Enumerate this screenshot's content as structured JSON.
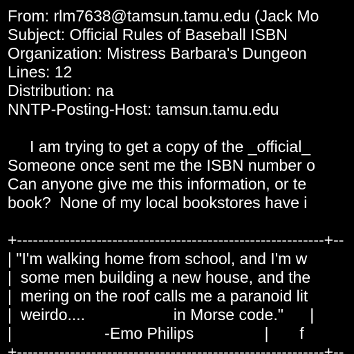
{
  "header": {
    "from": "From: rlm7638@tamsun.tamu.edu (Jack Mo",
    "subject": "Subject: Official Rules of Baseball ISBN",
    "organization": "Organization: Mistress Barbara's Dungeon",
    "lines": "Lines: 12",
    "distribution": "Distribution: na",
    "nntp_host": "NNTP-Posting-Host: tamsun.tamu.edu"
  },
  "body": [
    "     I am trying to get a copy of the _official_",
    "Someone once sent me the ISBN number o",
    "Can anyone give me this information, or te",
    "book?  None of my local bookstores have i"
  ],
  "signature": [
    "+----------------------------------------------------------+--",
    "| \"I'm walking home from school, and I'm w",
    "|  some men building a new house, and the",
    "|  mering on the roof calls me a paranoid lit",
    "|  weirdo....                    in Morse code.\"      |",
    "|                     -Emo Philips                |       f",
    "+----------------------------------------------------------+--"
  ]
}
